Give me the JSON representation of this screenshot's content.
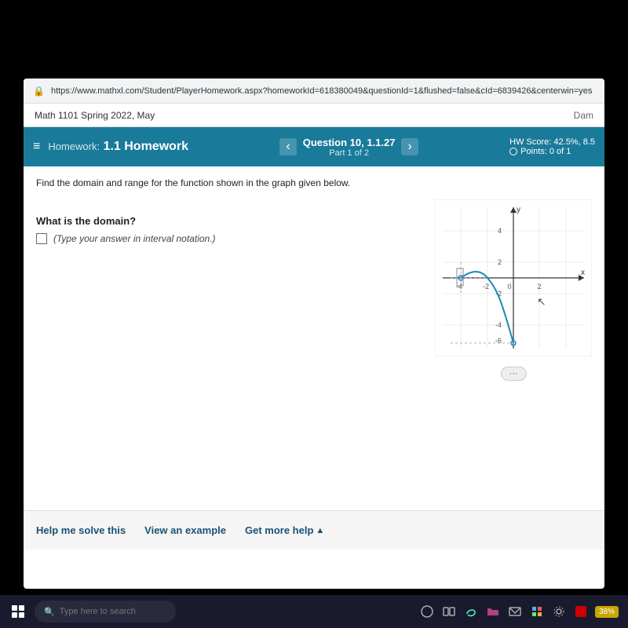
{
  "browser": {
    "url": "https://www.mathxl.com/Student/PlayerHomework.aspx?homeworkId=618380049&questionId=1&flushed=false&cId=6839426&centerwin=yes",
    "lock_icon": "🔒"
  },
  "site": {
    "course_title": "Math 1101 Spring 2022, May",
    "dam_label": "Dam"
  },
  "hw_header": {
    "menu_icon": "≡",
    "label": "Homework:",
    "title": "1.1 Homework",
    "nav_prev": "‹",
    "nav_next": "›",
    "question_number": "Question 10, 1.1.27",
    "question_part": "Part 1 of 2",
    "hw_score_label": "HW Score: 42.5%, 8.5",
    "points_label": "Points: 0 of 1"
  },
  "problem": {
    "instruction": "Find the domain and range for the function shown in the graph given below.",
    "domain_question": "What is the domain?",
    "answer_hint": "(Type your answer in interval notation.)",
    "more_label": "···"
  },
  "help_bar": {
    "solve_label": "Help me solve this",
    "example_label": "View an example",
    "more_help_label": "Get more help",
    "arrow": "▲"
  },
  "taskbar": {
    "search_placeholder": "Type here to search",
    "percent": "38%"
  },
  "graph": {
    "x_min": -4,
    "x_max": 4,
    "y_min": -6,
    "y_max": 4,
    "axis_labels": {
      "x": "x",
      "y": "y"
    }
  }
}
